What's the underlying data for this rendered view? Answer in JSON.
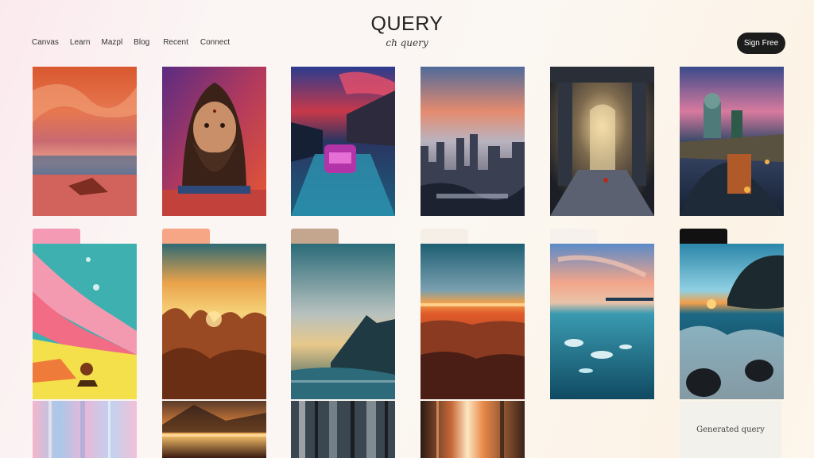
{
  "nav": {
    "items": [
      "Canvas",
      "Learn",
      "Mazpl",
      "Blog",
      "Recent",
      "Connect"
    ]
  },
  "brand": {
    "title": "QUERY",
    "tagline": "ch query"
  },
  "cta": {
    "label": "Sign Free"
  },
  "gallery": {
    "caption": "Generated query",
    "images": [
      {
        "icon": "painted-seascape-image"
      },
      {
        "icon": "bearded-man-portrait-image"
      },
      {
        "icon": "neon-city-street-image"
      },
      {
        "icon": "city-skyline-sunset-image"
      },
      {
        "icon": "ruined-hall-doorway-image"
      },
      {
        "icon": "night-temple-city-image"
      },
      {
        "icon": "abstract-beach-figure-image"
      },
      {
        "icon": "golden-forest-sunset-image"
      },
      {
        "icon": "misty-mountain-sea-image"
      },
      {
        "icon": "sunset-crowd-sea-image"
      },
      {
        "icon": "turquoise-ocean-sunset-image"
      },
      {
        "icon": "rocky-shore-waves-image"
      },
      {
        "icon": "pastel-blur-image"
      },
      {
        "icon": "sunset-lake-image"
      },
      {
        "icon": "dark-streak-blur-image"
      },
      {
        "icon": "light-streak-blur-image"
      }
    ],
    "tab_colors": [
      "#f59ab5",
      "#f6a684",
      "#c4a58e",
      "#f6efe8",
      "#f6f1ec",
      "#111111"
    ]
  }
}
